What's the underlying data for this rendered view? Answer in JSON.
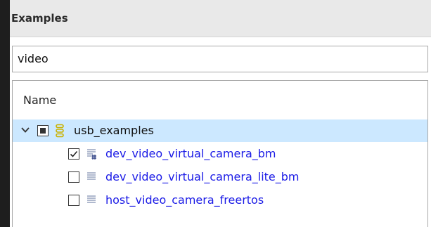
{
  "panel": {
    "title": "Examples",
    "filter": {
      "value": "video"
    },
    "tree": {
      "column_header": "Name",
      "root": {
        "label": "usb_examples",
        "expanded": true,
        "check_state": "partial"
      },
      "children": [
        {
          "label": "dev_video_virtual_camera_bm",
          "checked": true
        },
        {
          "label": "dev_video_virtual_camera_lite_bm",
          "checked": false
        },
        {
          "label": "host_video_camera_freertos",
          "checked": false
        }
      ]
    }
  },
  "colors": {
    "selection": "#cce8ff",
    "link": "#1a1ae6",
    "group_icon": "#c9b200",
    "file_icon": "#8f9bb8"
  }
}
